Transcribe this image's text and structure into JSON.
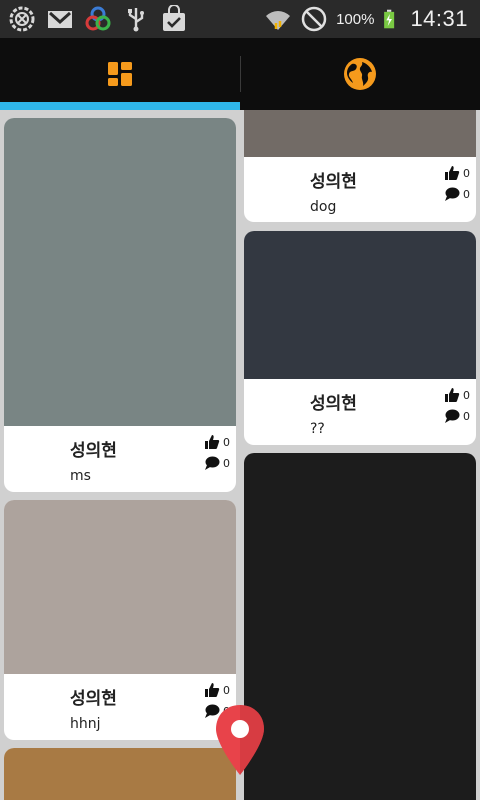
{
  "status_bar": {
    "left_icons": [
      "gear-badge-icon",
      "mail-icon",
      "sync-rings-icon",
      "usb-icon",
      "shopping-bag-icon"
    ],
    "right_icons": [
      "wifi-icon",
      "no-signal-icon",
      "battery-charging-icon"
    ],
    "battery_percent": "100%",
    "time": "14:31"
  },
  "tabs": [
    {
      "icon": "grid-icon",
      "selected": true
    },
    {
      "icon": "globe-icon",
      "selected": false
    }
  ],
  "colors": {
    "accent": "#2fb6ea",
    "tab_icon": "#f59a1c",
    "marker": "#e8434a"
  },
  "feed": {
    "left": [
      {
        "author": "성의현",
        "caption": "ms",
        "likes": "0",
        "comments": "0",
        "photo_color": "#798584"
      },
      {
        "author": "성의현",
        "caption": "hhnj",
        "likes": "0",
        "comments": "0",
        "photo_color": "#ada39d"
      },
      {
        "photo_color": "#a87a44"
      }
    ],
    "right": [
      {
        "author": "성의현",
        "caption": "dog",
        "likes": "0",
        "comments": "0",
        "photo_color": "#726b66"
      },
      {
        "author": "성의현",
        "caption": "??",
        "likes": "0",
        "comments": "0",
        "photo_color": "#333841"
      },
      {
        "photo_color": "#1c1c1c"
      }
    ]
  },
  "map_marker_icon": "map-pin-icon"
}
